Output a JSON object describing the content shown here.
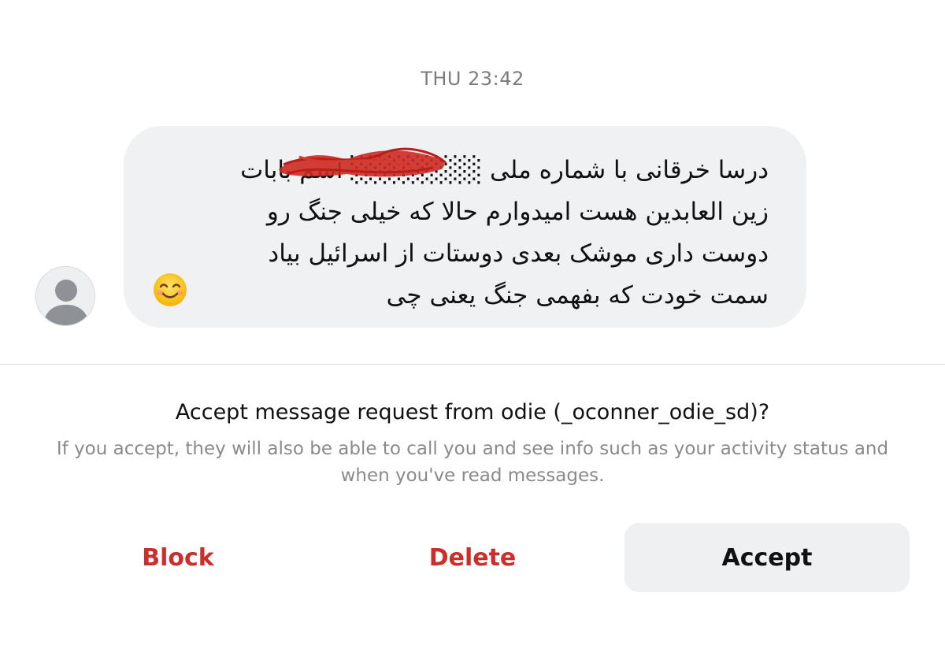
{
  "thread": {
    "timestamp": "THU 23:42"
  },
  "message": {
    "text": "درسا خرقانی با شماره ملی ░░░░░░░ اسم بابات\nزین العابدین هست امیدوارم حالا که خیلی جنگ رو\nدوست داری موشک بعدی دوستات از اسرائیل بیاد\nسمت خودت که بفهمی جنگ یعنی چی",
    "emoji_icon": "smiling-face-icon",
    "redaction_color": "#cc2a22"
  },
  "request": {
    "title": "Accept message request from odie (_oconner_odie_sd)?",
    "description": "If you accept, they will also be able to call you and see info such as your activity status and when you've read messages."
  },
  "actions": {
    "block_label": "Block",
    "delete_label": "Delete",
    "accept_label": "Accept",
    "destructive_color": "#c9302c"
  },
  "icons": {
    "avatar": "default-avatar-icon"
  }
}
